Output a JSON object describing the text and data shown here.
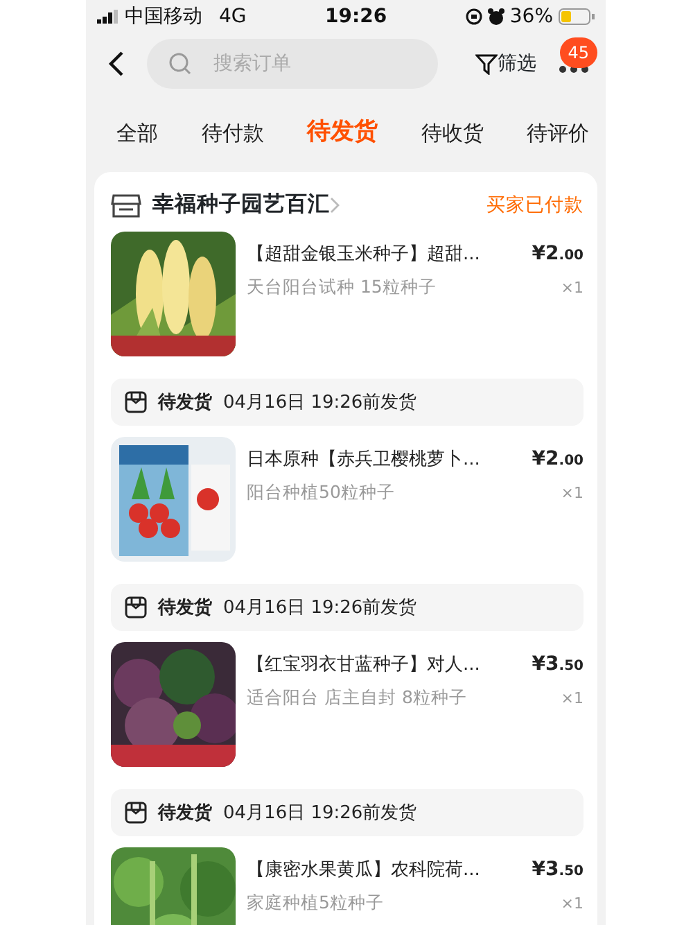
{
  "status_bar": {
    "carrier": "中国移动",
    "network": "4G",
    "time": "19:26",
    "battery": "36%"
  },
  "header": {
    "search": {
      "placeholder": "搜索订单"
    },
    "filter": "筛选",
    "badge": "45"
  },
  "tabs": [
    {
      "label": "全部",
      "selected": false
    },
    {
      "label": "待付款",
      "selected": false
    },
    {
      "label": "待发货",
      "selected": true
    },
    {
      "label": "待收货",
      "selected": false
    },
    {
      "label": "待评价",
      "selected": false
    }
  ],
  "order": {
    "store": "幸福种子园艺百汇",
    "status": "买家已付款",
    "entries": [
      {
        "kind": "product",
        "title": "【超甜金银玉米种子】超甜...",
        "spec": "天台阳台试种 15粒种子",
        "price": "¥2.00",
        "quantity": "×1"
      },
      {
        "kind": "shipping",
        "state": "待发货",
        "deadline": "04月16日 19:26前发货"
      },
      {
        "kind": "product",
        "title": "日本原种【赤兵卫樱桃萝卜...",
        "spec": "阳台种植50粒种子",
        "price": "¥2.00",
        "quantity": "×1"
      },
      {
        "kind": "shipping",
        "state": "待发货",
        "deadline": "04月16日 19:26前发货"
      },
      {
        "kind": "product",
        "title": "【红宝羽衣甘蓝种子】对人...",
        "spec": "适合阳台 店主自封 8粒种子",
        "price": "¥3.50",
        "quantity": "×1"
      },
      {
        "kind": "shipping",
        "state": "待发货",
        "deadline": "04月16日 19:26前发货"
      },
      {
        "kind": "product",
        "title": "【康密水果黄瓜】农科院荷...",
        "spec": "家庭种植5粒种子",
        "price": "¥3.50",
        "quantity": "×1"
      }
    ]
  }
}
